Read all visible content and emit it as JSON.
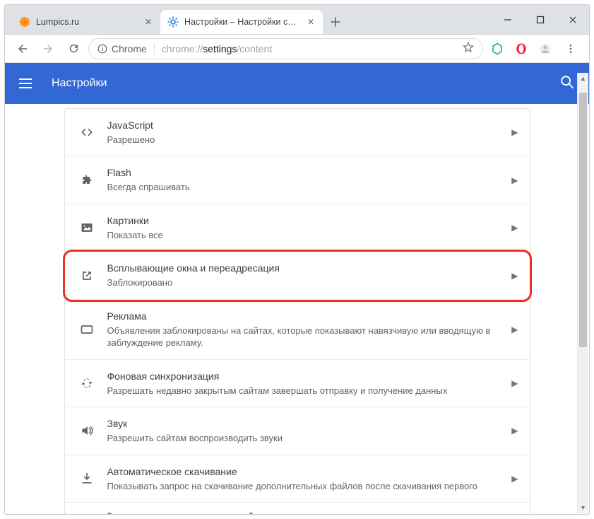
{
  "window": {
    "title": "Настройки – Настройки сайта"
  },
  "tabs": [
    {
      "label": "Lumpics.ru",
      "active": false,
      "favicon": "orange"
    },
    {
      "label": "Настройки – Настройки сайта",
      "active": true,
      "favicon": "gear"
    }
  ],
  "newtab_icon": "plus",
  "address": {
    "chip": "Chrome",
    "url_prefix": "chrome://",
    "url_main": "settings",
    "url_suffix": "/content"
  },
  "extensions": [
    "yandex",
    "opera"
  ],
  "header": {
    "title": "Настройки"
  },
  "settings": [
    {
      "id": "javascript",
      "icon": "code",
      "title": "JavaScript",
      "desc": "Разрешено"
    },
    {
      "id": "flash",
      "icon": "puzzle",
      "title": "Flash",
      "desc": "Всегда спрашивать"
    },
    {
      "id": "images",
      "icon": "image",
      "title": "Картинки",
      "desc": "Показать все"
    },
    {
      "id": "popups",
      "icon": "launch",
      "title": "Всплывающие окна и переадресация",
      "desc": "Заблокировано",
      "highlighted": true
    },
    {
      "id": "ads",
      "icon": "rect",
      "title": "Реклама",
      "desc": "Объявления заблокированы на сайтах, которые показывают навязчивую или вводящую в заблуждение рекламу."
    },
    {
      "id": "bg-sync",
      "icon": "sync",
      "title": "Фоновая синхронизация",
      "desc": "Разрешать недавно закрытым сайтам завершать отправку и получение данных"
    },
    {
      "id": "sound",
      "icon": "volume",
      "title": "Звук",
      "desc": "Разрешить сайтам воспроизводить звуки"
    },
    {
      "id": "downloads",
      "icon": "download",
      "title": "Автоматическое скачивание",
      "desc": "Показывать запрос на скачивание дополнительных файлов после скачивания первого"
    },
    {
      "id": "plugins",
      "icon": "",
      "title": "Доступ к плагинам вне тестовой среды",
      "desc": "",
      "peek": true
    }
  ]
}
